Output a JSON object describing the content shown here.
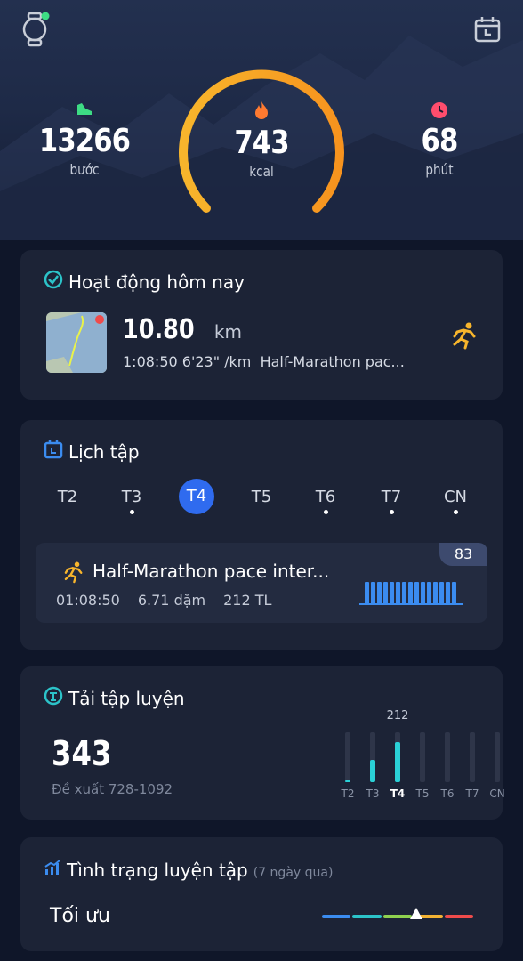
{
  "header": {
    "watch_icon": "watch-icon",
    "calendar_icon": "calendar-icon"
  },
  "stats": {
    "steps": {
      "value": "13266",
      "unit": "bước",
      "icon": "shoe-icon",
      "color": "#3ddc84"
    },
    "calories": {
      "value": "743",
      "unit": "kcal",
      "icon": "flame-icon",
      "color": "#ff8a3d"
    },
    "minutes": {
      "value": "68",
      "unit": "phút",
      "icon": "clock-icon",
      "color": "#ff4d6d"
    }
  },
  "activity": {
    "title": "Hoạt động hôm nay",
    "distance": "10.80",
    "distance_unit": "km",
    "details": "1:08:50 6'23\" /km  Half-Marathon pac...",
    "run_icon": "runner-icon"
  },
  "schedule": {
    "title": "Lịch tập",
    "days": [
      {
        "label": "T2",
        "dot": false,
        "active": false
      },
      {
        "label": "T3",
        "dot": true,
        "active": false
      },
      {
        "label": "T4",
        "dot": false,
        "active": true
      },
      {
        "label": "T5",
        "dot": false,
        "active": false
      },
      {
        "label": "T6",
        "dot": true,
        "active": false
      },
      {
        "label": "T7",
        "dot": true,
        "active": false
      },
      {
        "label": "CN",
        "dot": true,
        "active": false
      }
    ],
    "workout": {
      "name": "Half-Marathon pace inter...",
      "time": "01:08:50",
      "distance": "6.71 dặm",
      "load": "212 TL",
      "score": "83"
    }
  },
  "training_load": {
    "title": "Tải tập luyện",
    "value": "343",
    "suggestion": "Đề xuất 728-1092",
    "peak_label": "212",
    "days": [
      "T2",
      "T3",
      "T4",
      "T5",
      "T6",
      "T7",
      "CN"
    ],
    "levels": [
      0,
      0.45,
      0.8,
      0,
      0,
      0,
      0
    ],
    "active_day": "T4"
  },
  "training_status": {
    "title": "Tình trạng luyện tập",
    "period": "(7 ngày qua)",
    "status": "Tối ưu",
    "scale_colors": [
      "#3b8cf0",
      "#2cc3c9",
      "#8fd14f",
      "#f2b233",
      "#ef4b4b"
    ],
    "marker_position": 0.62
  }
}
